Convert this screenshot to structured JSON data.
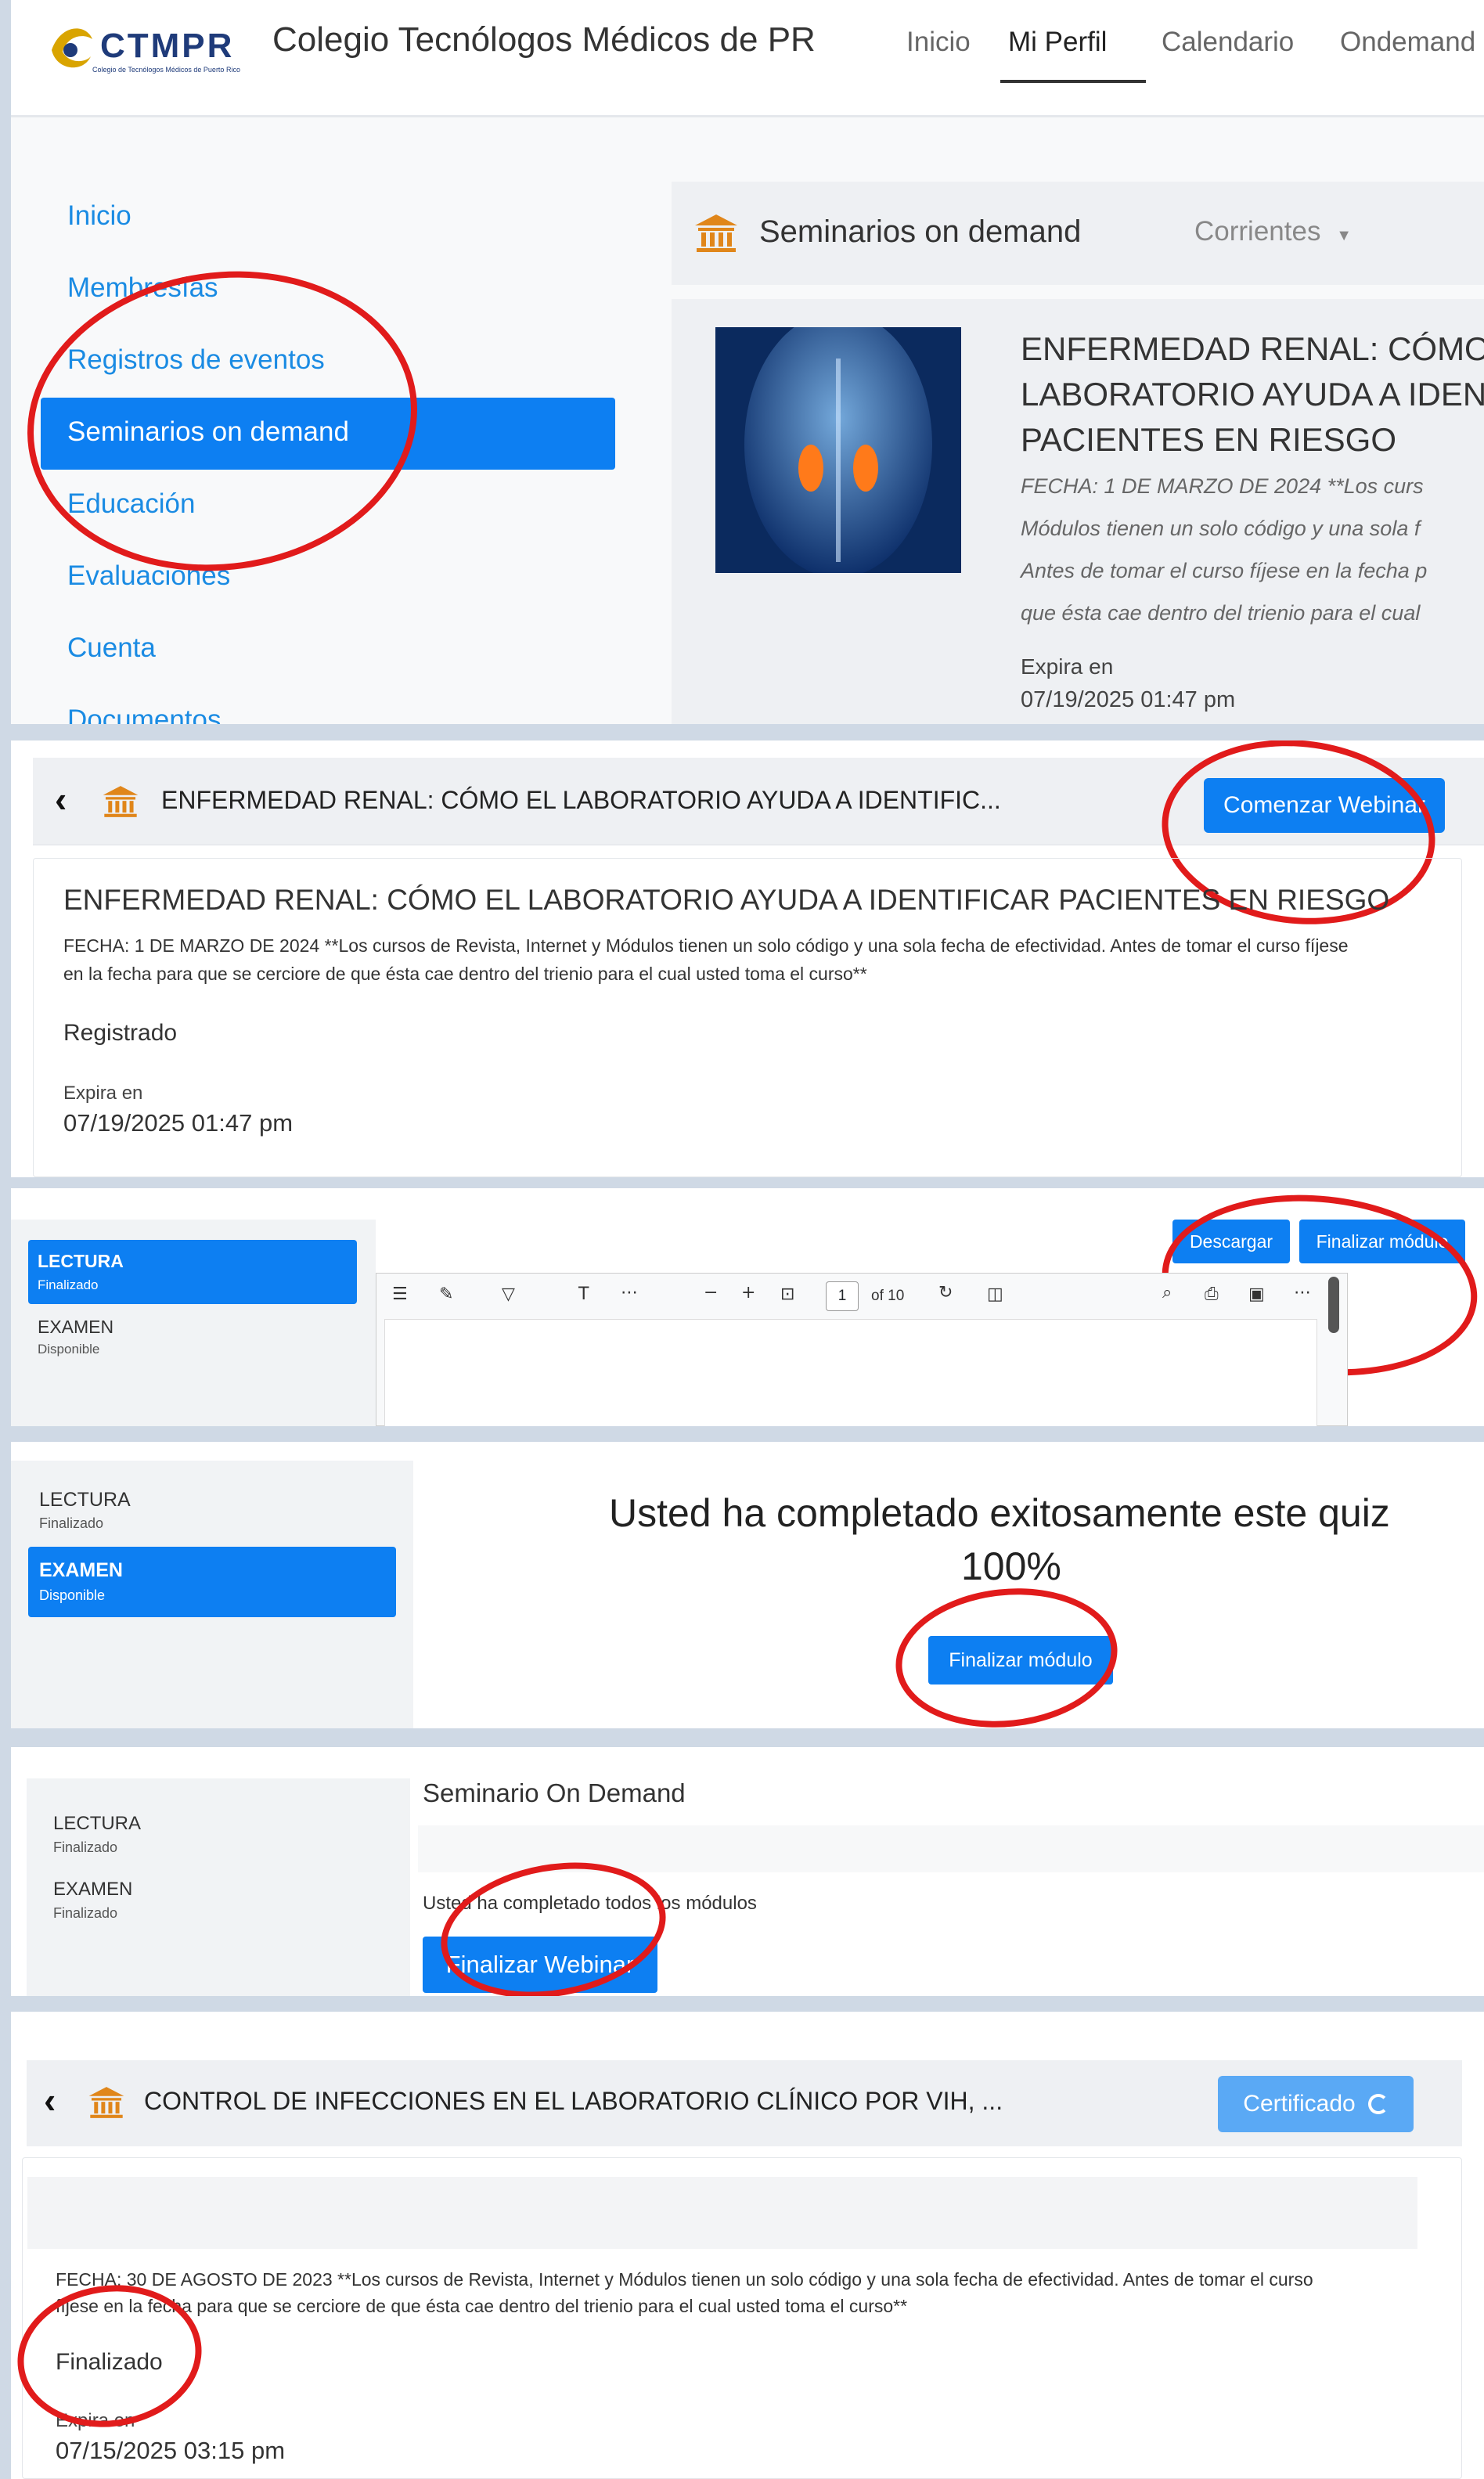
{
  "colors": {
    "accent": "#0d7ff2",
    "annotation": "#e11b1b",
    "logo_gold": "#d9a400",
    "logo_navy": "#1f3b7a"
  },
  "s1": {
    "logo": {
      "text": "CTMPR",
      "subtext": "Colegio de Tecnólogos Médicos de Puerto Rico"
    },
    "site_title": "Colegio Tecnólogos Médicos de PR",
    "nav": [
      "Inicio",
      "Mi Perfil",
      "Calendario",
      "Ondemand"
    ],
    "sidebar": [
      "Inicio",
      "Membresías",
      "Registros de eventos",
      "Seminarios on demand",
      "Educación",
      "Evaluaciones",
      "Cuenta",
      "Documentos"
    ],
    "section_title": "Seminarios on demand",
    "filter": "Corrientes",
    "card": {
      "title_lines": [
        "ENFERMEDAD RENAL: CÓMO",
        "LABORATORIO AYUDA A IDEN",
        "PACIENTES EN RIESGO"
      ],
      "desc_lines": [
        "FECHA: 1 DE MARZO DE 2024 **Los curs",
        "Módulos tienen un solo código y una sola f",
        "Antes de tomar el curso fíjese en la fecha p",
        "que ésta cae dentro del trienio para el cual"
      ],
      "expira_label": "Expira en",
      "expira_value": "07/19/2025 01:47 pm"
    }
  },
  "s2": {
    "header_title": "ENFERMEDAD RENAL: CÓMO EL LABORATORIO AYUDA A IDENTIFIC...",
    "button": "Comenzar Webinar",
    "title": "ENFERMEDAD RENAL: CÓMO EL LABORATORIO AYUDA A IDENTIFICAR PACIENTES EN RIESGO",
    "desc_line1": "FECHA: 1 DE MARZO DE 2024 **Los cursos de Revista, Internet y Módulos tienen un solo código y una sola fecha de efectividad. Antes de tomar el curso fíjese",
    "desc_line2": "en la fecha para que se cerciore de que ésta cae dentro del trienio para el cual usted toma el curso**",
    "status": "Registrado",
    "expira_label": "Expira en",
    "expira_value": "07/19/2025 01:47 pm"
  },
  "s3": {
    "modules": [
      {
        "name": "LECTURA",
        "status": "Finalizado"
      },
      {
        "name": "EXAMEN",
        "status": "Disponible"
      }
    ],
    "btn_download": "Descargar",
    "btn_finish": "Finalizar módulo",
    "pdf_page": "1",
    "pdf_total": "of 10"
  },
  "s4": {
    "modules": [
      {
        "name": "LECTURA",
        "status": "Finalizado"
      },
      {
        "name": "EXAMEN",
        "status": "Disponible"
      }
    ],
    "message": "Usted ha completado exitosamente este quiz",
    "score": "100%",
    "button": "Finalizar módulo"
  },
  "s5": {
    "modules": [
      {
        "name": "LECTURA",
        "status": "Finalizado"
      },
      {
        "name": "EXAMEN",
        "status": "Finalizado"
      }
    ],
    "title": "Seminario On Demand",
    "message": "Usted ha completado todos los módulos",
    "button": "Finalizar Webinar"
  },
  "s6": {
    "header_title": "CONTROL DE INFECCIONES EN EL LABORATORIO CLÍNICO POR VIH, ...",
    "button": "Certificado",
    "desc_line1": "FECHA: 30 DE AGOSTO DE 2023 **Los cursos de Revista, Internet y Módulos tienen un solo código y una sola fecha de efectividad. Antes de tomar el curso",
    "desc_line2": "fíjese en la fecha para que se cerciore de que ésta cae dentro del trienio para el cual usted toma el curso**",
    "status": "Finalizado",
    "expira_label": "Expira en",
    "expira_value": "07/15/2025 03:15 pm"
  }
}
